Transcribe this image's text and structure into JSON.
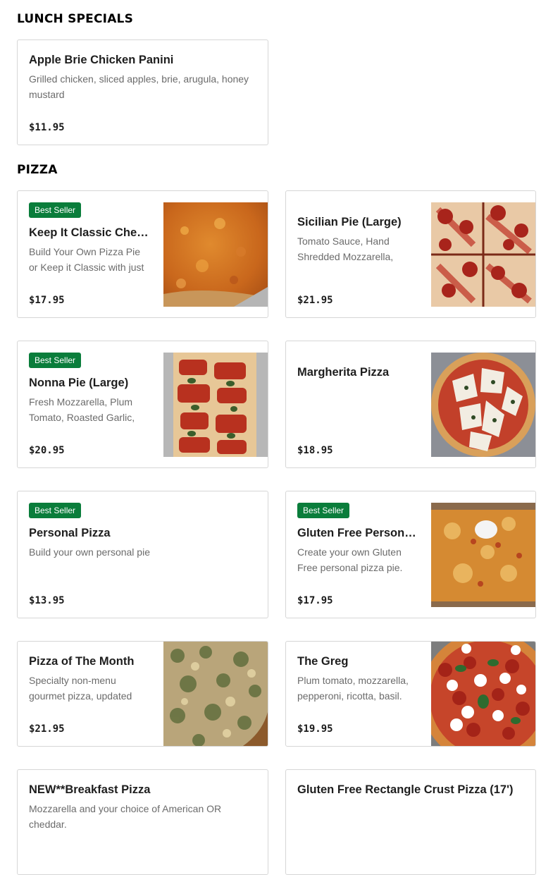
{
  "sections": [
    {
      "title": "LUNCH SPECIALS",
      "items": [
        {
          "name": "Apple Brie Chicken Panini",
          "description": "Grilled chicken, sliced apples, brie, arugula, honey mustard",
          "price": "$11.95"
        }
      ]
    },
    {
      "title": "PIZZA",
      "items": [
        {
          "badge": "Best Seller",
          "name": "Keep It Classic Cheese Pie (Large)",
          "description": "Build Your Own Pizza Pie or Keep it Classic with just cheese.",
          "price": "$17.95",
          "image": "pizza-cheese-photo"
        },
        {
          "name": "Sicilian Pie (Large)",
          "description": "Tomato Sauce, Hand Shredded Mozzarella, Parmesan.",
          "price": "$21.95",
          "image": "sicilian-pepperoni-photo"
        },
        {
          "badge": "Best Seller",
          "name": "Nonna Pie (Large)",
          "description": "Fresh Mozzarella, Plum Tomato, Roasted Garlic, Basil.",
          "price": "$20.95",
          "image": "nonna-pie-photo"
        },
        {
          "name": "Margherita Pizza",
          "description": "",
          "price": "$18.95",
          "image": "margherita-photo"
        },
        {
          "badge": "Best Seller",
          "name": "Personal Pizza",
          "description": "Build your own personal pie",
          "price": "$13.95"
        },
        {
          "badge": "Best Seller",
          "name": "Gluten Free Personal Pizza",
          "description": "Create your own Gluten Free personal pizza pie. Add toppings.",
          "price": "$17.95",
          "image": "gluten-free-pizza-photo"
        },
        {
          "name": "Pizza of The Month",
          "description": "Specialty non-menu gourmet pizza, updated monthly.",
          "price": "$21.95",
          "image": "spinach-pizza-photo"
        },
        {
          "name": "The Greg",
          "description": "Plum tomato, mozzarella, pepperoni, ricotta, basil.",
          "price": "$19.95",
          "image": "greg-pizza-photo"
        },
        {
          "name": "NEW**Breakfast Pizza",
          "description": "Mozzarella and your choice of American OR cheddar.",
          "price": ""
        },
        {
          "name": "Gluten Free Rectangle Crust Pizza (17')",
          "description": "",
          "price": ""
        }
      ]
    }
  ]
}
